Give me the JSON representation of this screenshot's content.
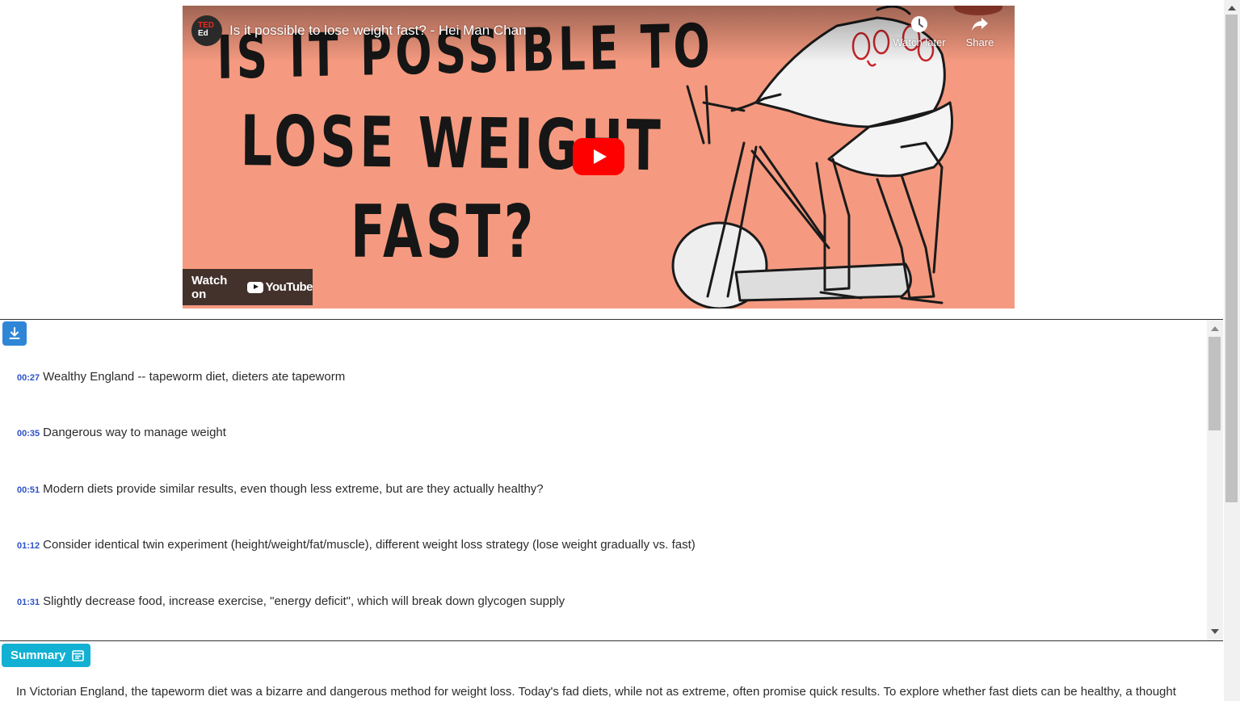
{
  "video": {
    "title": "Is it possible to lose weight fast? - Hei Man Chan",
    "channel_logo_line1": "TED",
    "channel_logo_line2": "Ed",
    "thumbnail_line1": "IS IT POSSIBLE TO",
    "thumbnail_line2": "LOSE WEIGHT",
    "thumbnail_line3": "FAST?",
    "watch_later_label": "Watch later",
    "share_label": "Share",
    "watch_on_label": "Watch on",
    "youtube_logo_text": "YouTube"
  },
  "transcript": {
    "download_icon": "download-icon",
    "items": [
      {
        "time": "00:27",
        "text": "Wealthy England -- tapeworm diet, dieters ate tapeworm"
      },
      {
        "time": "00:35",
        "text": "Dangerous way to manage weight"
      },
      {
        "time": "00:51",
        "text": "Modern diets provide similar results, even though less extreme, but are they actually healthy?"
      },
      {
        "time": "01:12",
        "text": "Consider identical twin experiment (height/weight/fat/muscle), different weight loss strategy (lose weight gradually vs. fast)"
      },
      {
        "time": "01:31",
        "text": "Slightly decrease food, increase exercise, \"energy deficit\", which will break down glycogen supply"
      }
    ]
  },
  "summary": {
    "button_label": "Summary",
    "text": "In Victorian England, the tapeworm diet was a bizarre and dangerous method for weight loss. Today's fad diets, while not as extreme, often promise quick results. To explore whether fast diets can be healthy, a thought"
  },
  "colors": {
    "thumbnail_bg": "#f59a80",
    "play_red": "#ff0000",
    "download_blue": "#2f86d6",
    "summary_cyan": "#12b1d3",
    "timestamp_blue": "#2d52c5"
  }
}
